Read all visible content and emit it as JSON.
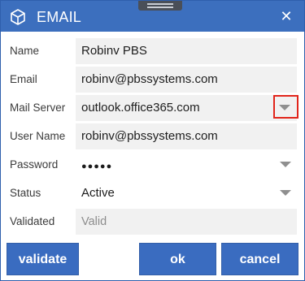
{
  "window": {
    "title": "EMAIL",
    "close_symbol": "✕",
    "app_icon": "cube-icon",
    "accent_color": "#3c6fbe"
  },
  "form": {
    "name": {
      "label": "Name",
      "value": "Robinv PBS"
    },
    "email": {
      "label": "Email",
      "value": "robinv@pbssystems.com"
    },
    "mail_server": {
      "label": "Mail Server",
      "value": "outlook.office365.com"
    },
    "user_name": {
      "label": "User Name",
      "value": "robinv@pbssystems.com"
    },
    "password": {
      "label": "Password",
      "value": "●●●●●"
    },
    "status": {
      "label": "Status",
      "value": "Active"
    },
    "validated": {
      "label": "Validated",
      "placeholder": "Valid"
    }
  },
  "buttons": {
    "validate": "validate",
    "ok": "ok",
    "cancel": "cancel"
  },
  "annotation": {
    "highlight_color": "#e1251b"
  }
}
